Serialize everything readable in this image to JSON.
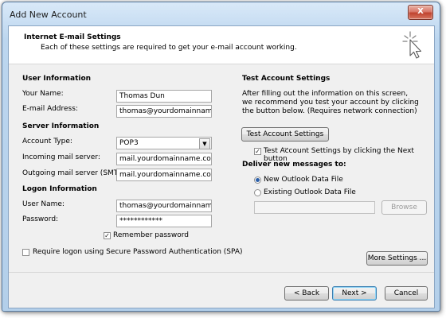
{
  "window": {
    "title": "Add New Account",
    "close_label": "X"
  },
  "header": {
    "title": "Internet E-mail Settings",
    "subtitle": "Each of these settings are required to get your e-mail account working."
  },
  "user_info": {
    "title": "User Information",
    "name_label": "Your Name:",
    "name_value": "Thomas Dun",
    "email_label": "E-mail Address:",
    "email_value": "thomas@yourdomainname.com"
  },
  "server_info": {
    "title": "Server Information",
    "account_type_label": "Account Type:",
    "account_type_value": "POP3",
    "incoming_label": "Incoming mail server:",
    "incoming_value": "mail.yourdomainname.com",
    "outgoing_label": "Outgoing mail server (SMTP):",
    "outgoing_value": "mail.yourdomainname.com"
  },
  "logon_info": {
    "title": "Logon Information",
    "username_label": "User Name:",
    "username_value": "thomas@yourdomainname.com",
    "password_label": "Password:",
    "password_value": "************",
    "remember_label": "Remember password",
    "remember_checked": true,
    "spa_label": "Require logon using Secure Password Authentication (SPA)",
    "spa_checked": false
  },
  "test": {
    "title": "Test Account Settings",
    "description": "After filling out the information on this screen, we recommend you test your account by clicking the button below. (Requires network connection)",
    "button": "Test Account Settings ...",
    "next_check_label": "Test Account Settings by clicking the Next button",
    "next_check_checked": true
  },
  "deliver": {
    "title": "Deliver new messages to:",
    "option_new": "New Outlook Data File",
    "option_existing": "Existing Outlook Data File",
    "browse": "Browse"
  },
  "buttons": {
    "more_settings": "More Settings ...",
    "back": "< Back",
    "next": "Next >",
    "cancel": "Cancel"
  }
}
